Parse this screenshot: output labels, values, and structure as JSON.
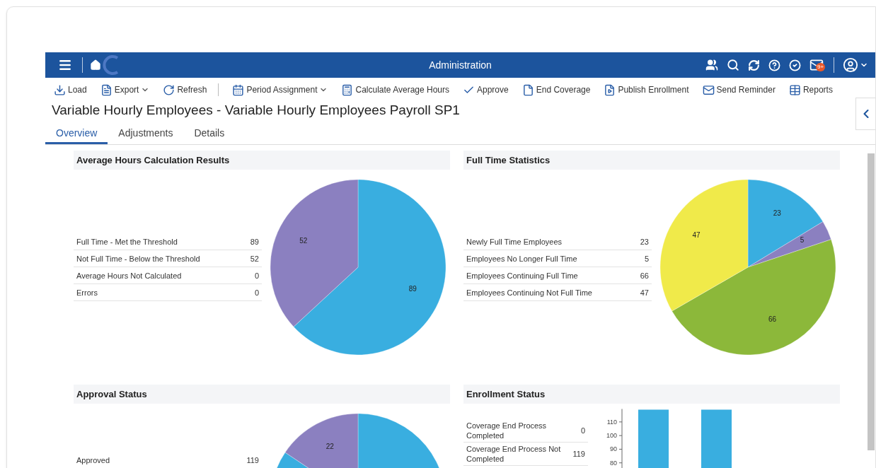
{
  "header": {
    "title": "Administration",
    "mail_badge": "9+"
  },
  "toolbar": [
    {
      "label": "Load",
      "has_menu": false,
      "separator_after": false
    },
    {
      "label": "Export",
      "has_menu": true,
      "separator_after": false
    },
    {
      "label": "Refresh",
      "has_menu": false,
      "separator_after": true
    },
    {
      "label": "Period Assignment",
      "has_menu": true,
      "separator_after": false
    },
    {
      "label": "Calculate Average Hours",
      "has_menu": false,
      "separator_after": false
    },
    {
      "label": "Approve",
      "has_menu": false,
      "separator_after": false
    },
    {
      "label": "End Coverage",
      "has_menu": false,
      "separator_after": false
    },
    {
      "label": "Publish Enrollment",
      "has_menu": false,
      "separator_after": false
    },
    {
      "label": "Send Reminder",
      "has_menu": false,
      "separator_after": false
    },
    {
      "label": "Reports",
      "has_menu": false,
      "separator_after": false
    }
  ],
  "page_title": "Variable Hourly Employees - Variable Hourly Employees Payroll SP1",
  "tabs": [
    {
      "label": "Overview",
      "selected": true
    },
    {
      "label": "Adjustments",
      "selected": false
    },
    {
      "label": "Details",
      "selected": false
    }
  ],
  "panels": [
    {
      "title": "Average Hours Calculation Results",
      "rows": [
        {
          "label": "Full Time - Met the Threshold",
          "value": "89"
        },
        {
          "label": "Not Full Time - Below the Threshold",
          "value": "52"
        },
        {
          "label": "Average Hours Not Calculated",
          "value": "0"
        },
        {
          "label": "Errors",
          "value": "0"
        }
      ],
      "chart_data": {
        "type": "pie",
        "values": [
          89,
          52
        ],
        "colors": [
          "#39aee0",
          "#8b80c0"
        ],
        "value_labels": [
          "89",
          "52"
        ]
      }
    },
    {
      "title": "Full Time Statistics",
      "rows": [
        {
          "label": "Newly Full Time Employees",
          "value": "23"
        },
        {
          "label": "Employees No Longer Full Time",
          "value": "5"
        },
        {
          "label": "Employees Continuing Full Time",
          "value": "66"
        },
        {
          "label": "Employees Continuing Not Full Time",
          "value": "47"
        }
      ],
      "chart_data": {
        "type": "pie",
        "values": [
          23,
          5,
          66,
          47
        ],
        "colors": [
          "#39aee0",
          "#8b80c0",
          "#8cb83a",
          "#f0ea4a"
        ],
        "value_labels": [
          "23",
          "5",
          "66",
          "47"
        ]
      }
    },
    {
      "title": "Approval Status",
      "rows": [
        {
          "label": "Approved",
          "value": "119"
        }
      ],
      "chart_data": {
        "type": "pie",
        "values": [
          119,
          22
        ],
        "colors": [
          "#39aee0",
          "#8b80c0"
        ],
        "value_labels": [
          null,
          "22"
        ]
      }
    },
    {
      "title": "Enrollment Status",
      "rows": [
        {
          "label": "Coverage End Process Completed",
          "value": "0"
        },
        {
          "label": "Coverage End Process Not Completed",
          "value": "119"
        }
      ],
      "chart_data": {
        "type": "bar",
        "categories": [
          null,
          null
        ],
        "values": [
          119,
          119
        ],
        "color": "#39aee0",
        "ylim": [
          0,
          119.5
        ],
        "yticks": [
          80,
          90,
          100,
          110
        ]
      }
    }
  ]
}
